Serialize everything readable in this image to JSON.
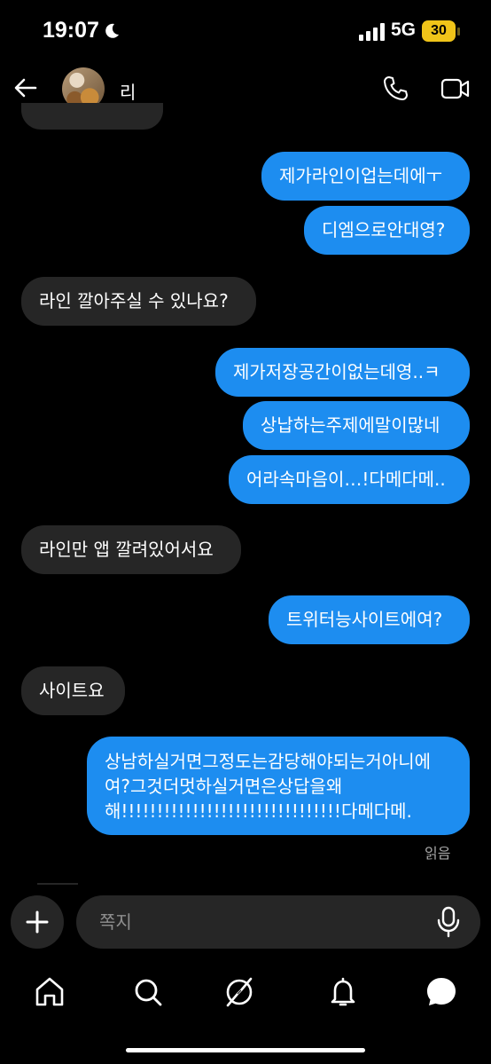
{
  "status_bar": {
    "time": "19:07",
    "network": "5G",
    "battery": "30"
  },
  "header": {
    "contact_name": "리"
  },
  "messages": [
    {
      "side": "out",
      "text": "제가라인이업는데에ㅜ"
    },
    {
      "side": "out",
      "text": "디엠으로안대영?"
    },
    {
      "side": "in",
      "text": "라인 깔아주실 수 있나요?"
    },
    {
      "side": "out",
      "text": "제가저장공간이없는데영..ㅋ"
    },
    {
      "side": "out",
      "text": "상납하는주제에말이많네"
    },
    {
      "side": "out",
      "text": "어라속마음이…!다메다메.."
    },
    {
      "side": "in",
      "text": "라인만 앱 깔려있어서요"
    },
    {
      "side": "out",
      "text": "트위터능사이트에여?"
    },
    {
      "side": "in",
      "text": "사이트요"
    },
    {
      "side": "out",
      "text": "상남하실거면그정도는감당해야되는거아니에여?그것더멋하실거면은상답을왜해!!!!!!!!!!!!!!!!!!!!!!!!!!!!!!!다메다메."
    }
  ],
  "read_receipt": "읽음",
  "composer": {
    "placeholder": "쪽지"
  },
  "icons": {
    "back": "back-arrow-icon",
    "call": "phone-icon",
    "video": "video-camera-icon",
    "plus": "plus-icon",
    "mic": "microphone-icon",
    "tabs": [
      "home-icon",
      "search-icon",
      "explore-icon",
      "notifications-icon",
      "messages-icon"
    ]
  },
  "colors": {
    "outgoing": "#1d8df0",
    "incoming": "#262626",
    "background": "#000000",
    "battery": "#f0c419"
  }
}
